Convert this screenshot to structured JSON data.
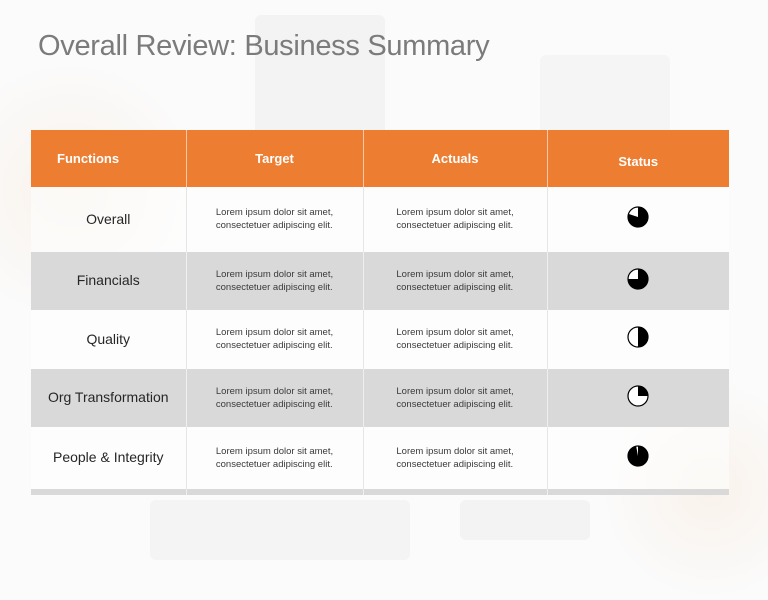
{
  "slide": {
    "title": "Overall Review: Business Summary"
  },
  "colors": {
    "header_bg": "#ed7d31",
    "header_text": "#ffffff",
    "alt_row_bg": "#d9d9d9",
    "title_text": "#7b7b7b",
    "status_fill": "#000000"
  },
  "table": {
    "columns": [
      "Functions",
      "Target",
      "Actuals",
      "Status"
    ],
    "rows": [
      {
        "function": "Overall",
        "target": [
          "Lorem  ipsum dolor sit amet,",
          "consectetuer  adipiscing elit."
        ],
        "actuals": [
          "Lorem  ipsum dolor sit amet,",
          "consectetuer  adipiscing elit."
        ],
        "status_icon": "harvey-ball-icon",
        "status_fraction": 0.8
      },
      {
        "function": "Financials",
        "target": [
          "Lorem  ipsum dolor sit amet,",
          "consectetuer  adipiscing elit."
        ],
        "actuals": [
          "Lorem  ipsum dolor sit amet,",
          "consectetuer  adipiscing elit."
        ],
        "status_icon": "harvey-ball-icon",
        "status_fraction": 0.75
      },
      {
        "function": "Quality",
        "target": [
          "Lorem  ipsum dolor sit amet,",
          "consectetuer  adipiscing elit."
        ],
        "actuals": [
          "Lorem  ipsum dolor sit amet,",
          "consectetuer  adipiscing elit."
        ],
        "status_icon": "harvey-ball-icon",
        "status_fraction": 0.5
      },
      {
        "function": "Org Transformation",
        "target": [
          "Lorem  ipsum dolor sit amet,",
          "consectetuer  adipiscing elit."
        ],
        "actuals": [
          "Lorem  ipsum dolor sit amet,",
          "consectetuer  adipiscing elit."
        ],
        "status_icon": "harvey-ball-icon",
        "status_fraction": 0.25
      },
      {
        "function": "People & Integrity",
        "target": [
          "Lorem  ipsum dolor sit amet,",
          "consectetuer  adipiscing elit."
        ],
        "actuals": [
          "Lorem  ipsum dolor sit amet,",
          "consectetuer  adipiscing elit."
        ],
        "status_icon": "harvey-ball-icon",
        "status_fraction": 0.97
      }
    ]
  }
}
